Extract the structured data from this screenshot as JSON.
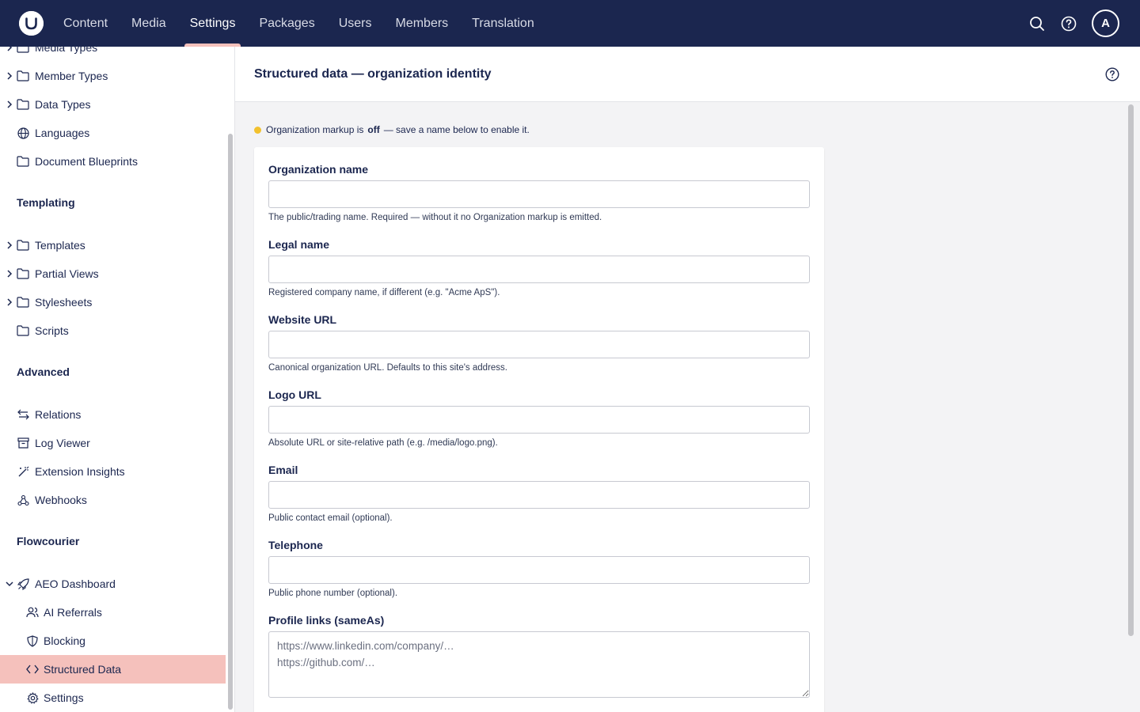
{
  "topbar": {
    "logo_alt": "Umbraco",
    "nav": [
      {
        "label": "Content"
      },
      {
        "label": "Media"
      },
      {
        "label": "Settings"
      },
      {
        "label": "Packages"
      },
      {
        "label": "Users"
      },
      {
        "label": "Members"
      },
      {
        "label": "Translation"
      }
    ],
    "active_nav": "Settings",
    "avatar_initial": "A"
  },
  "sidebar": {
    "items": [
      {
        "label": "Media Types",
        "icon": "folder-icon",
        "expandable": true
      },
      {
        "label": "Member Types",
        "icon": "folder-icon",
        "expandable": true
      },
      {
        "label": "Data Types",
        "icon": "folder-icon",
        "expandable": true
      },
      {
        "label": "Languages",
        "icon": "globe-icon",
        "expandable": false
      },
      {
        "label": "Document Blueprints",
        "icon": "folder-icon",
        "expandable": false
      }
    ],
    "templating": {
      "heading": "Templating",
      "items": [
        {
          "label": "Templates",
          "icon": "folder-icon",
          "expandable": true
        },
        {
          "label": "Partial Views",
          "icon": "folder-icon",
          "expandable": true
        },
        {
          "label": "Stylesheets",
          "icon": "folder-icon",
          "expandable": true
        },
        {
          "label": "Scripts",
          "icon": "folder-icon",
          "expandable": false
        }
      ]
    },
    "advanced": {
      "heading": "Advanced",
      "items": [
        {
          "label": "Relations",
          "icon": "arrows-icon"
        },
        {
          "label": "Log Viewer",
          "icon": "archive-icon"
        },
        {
          "label": "Extension Insights",
          "icon": "wand-icon"
        },
        {
          "label": "Webhooks",
          "icon": "webhook-icon"
        }
      ]
    },
    "flowcourier": {
      "heading": "Flowcourier",
      "parent": {
        "label": "AEO Dashboard",
        "icon": "rocket-icon",
        "expanded": true
      },
      "children": [
        {
          "label": "AI Referrals",
          "icon": "users-icon"
        },
        {
          "label": "Blocking",
          "icon": "shield-icon"
        },
        {
          "label": "Structured Data",
          "icon": "code-icon",
          "active": true
        },
        {
          "label": "Settings",
          "icon": "gear-icon"
        }
      ]
    }
  },
  "main": {
    "title": "Structured data — organization identity",
    "status": {
      "prefix": "Organization markup is",
      "state": "off",
      "suffix": "— save a name below to enable it."
    },
    "fields": [
      {
        "label": "Organization name",
        "value": "",
        "hint": "The public/trading name. Required — without it no Organization markup is emitted."
      },
      {
        "label": "Legal name",
        "value": "",
        "hint": "Registered company name, if different (e.g. \"Acme ApS\")."
      },
      {
        "label": "Website URL",
        "value": "",
        "hint": "Canonical organization URL. Defaults to this site's address."
      },
      {
        "label": "Logo URL",
        "value": "",
        "hint": "Absolute URL or site-relative path (e.g. /media/logo.png)."
      },
      {
        "label": "Email",
        "value": "",
        "hint": "Public contact email (optional)."
      },
      {
        "label": "Telephone",
        "value": "",
        "hint": "Public phone number (optional)."
      }
    ],
    "profile_links": {
      "label": "Profile links (sameAs)",
      "value": "",
      "placeholder": "https://www.linkedin.com/company/…\nhttps://github.com/…"
    }
  },
  "colors": {
    "topbar": "#1b264f",
    "accent": "#f5c1bc",
    "status_dot": "#f2c12e",
    "background": "#f3f3f5"
  }
}
